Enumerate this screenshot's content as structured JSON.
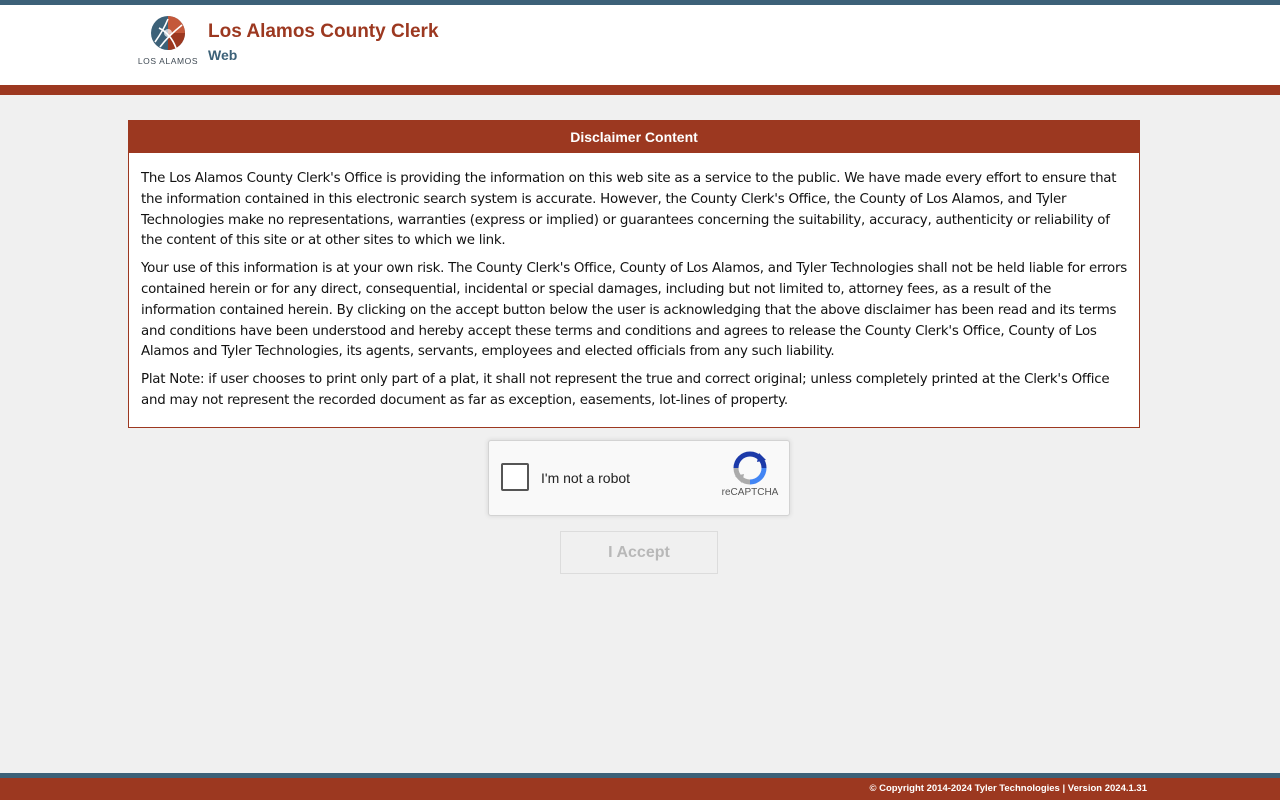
{
  "header": {
    "logo_text": "LOS ALAMOS",
    "title": "Los Alamos County Clerk",
    "subtitle": "Web"
  },
  "disclaimer": {
    "heading": "Disclaimer Content",
    "paragraphs": [
      "The Los Alamos County Clerk's Office is providing the information on this web site as a service to the public. We have made every effort to ensure that the information contained in this electronic search system is accurate. However, the County Clerk's Office, the County of Los Alamos, and Tyler Technologies make no representations, warranties (express or implied) or guarantees concerning the suitability, accuracy, authenticity or reliability of the content of this site or at other sites to which we link.",
      "Your use of this information is at your own risk. The County Clerk's Office, County of Los Alamos, and Tyler Technologies shall not be held liable for errors contained herein or for any direct, consequential, incidental or special damages, including but not limited to, attorney fees, as a result of the information contained herein. By clicking on the accept button below the user is acknowledging that the above disclaimer has been read and its terms and conditions have been understood and hereby accept these terms and conditions and agrees to release the County Clerk's Office, County of Los Alamos and Tyler Technologies, its agents, servants, employees and elected officials from any such liability.",
      "Plat Note: if user chooses to print only part of a plat, it shall not represent the true and correct original; unless completely printed at the Clerk's Office and may not represent the recorded document as far as exception, easements, lot-lines of property."
    ]
  },
  "captcha": {
    "label": "I'm not a robot",
    "brand": "reCAPTCHA"
  },
  "accept_button": {
    "label": "I Accept"
  },
  "footer": {
    "text": "© Copyright 2014-2024 Tyler Technologies | Version 2024.1.31"
  },
  "colors": {
    "brand_red": "#9c3820",
    "brand_blue": "#3c6178",
    "background": "#f0f0f0"
  },
  "icons": [
    "los-alamos-logo-icon",
    "recaptcha-logo-icon"
  ]
}
